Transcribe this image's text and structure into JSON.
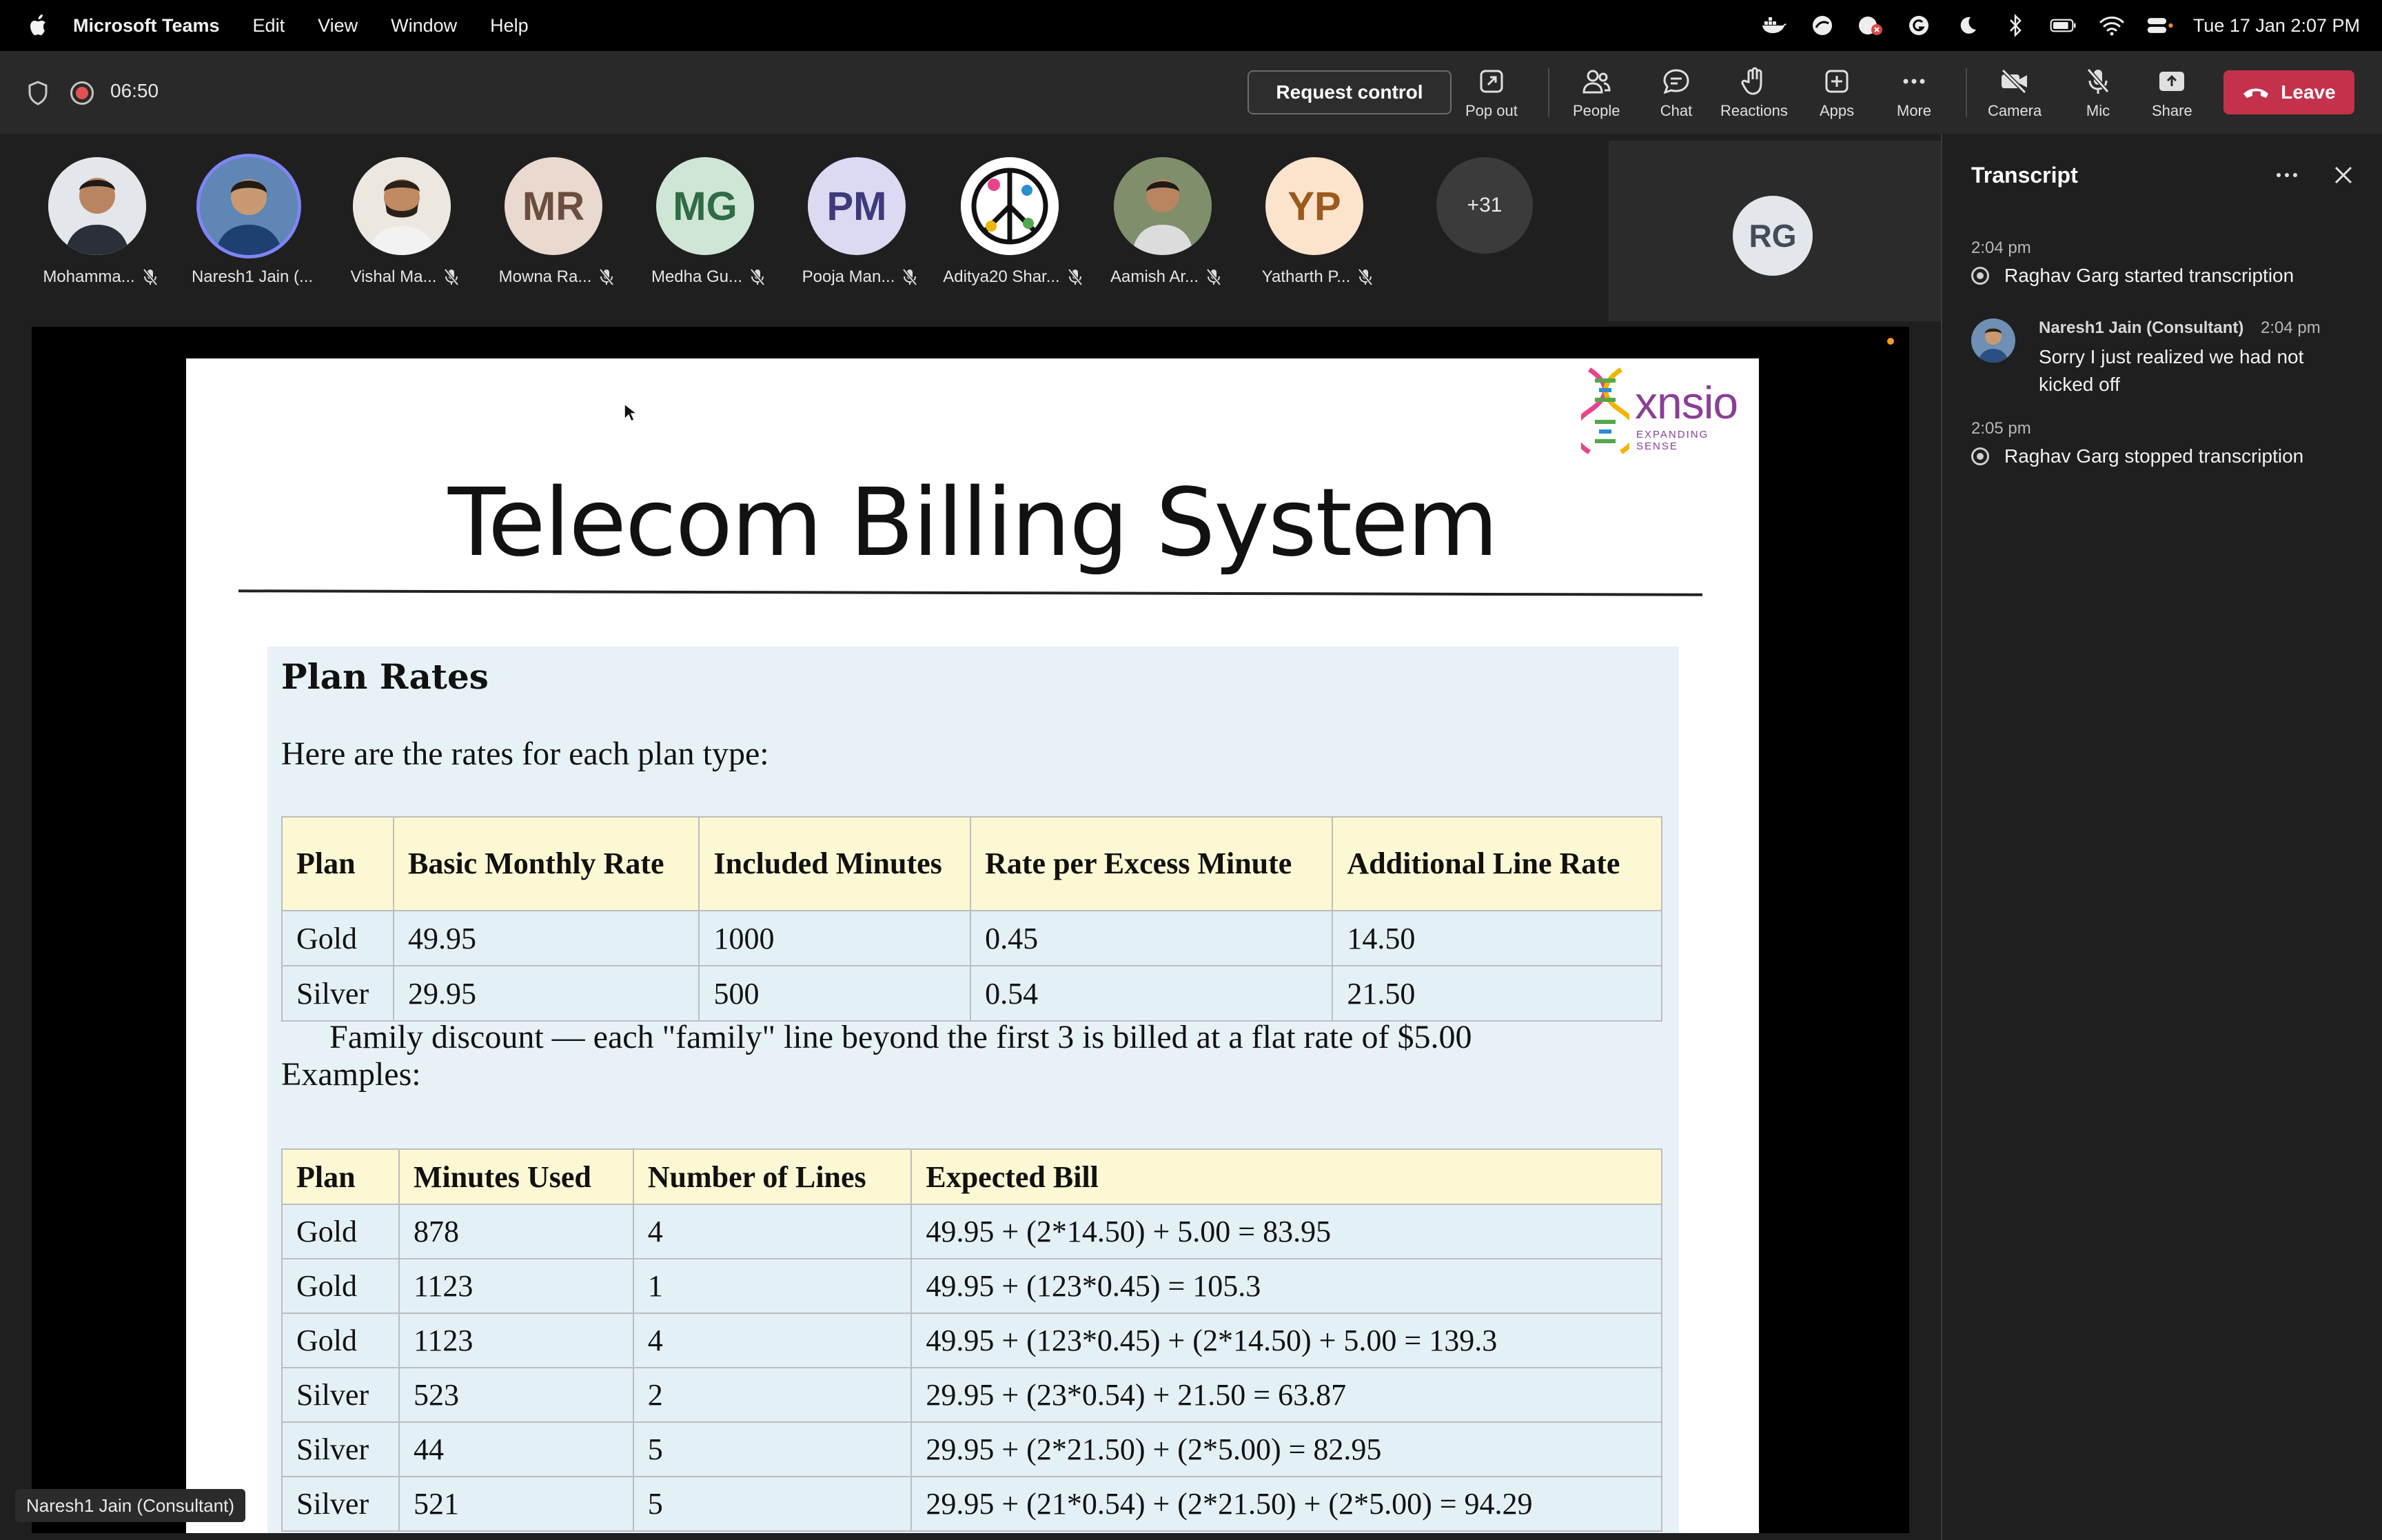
{
  "menubar": {
    "app_name": "Microsoft Teams",
    "items": [
      "Edit",
      "View",
      "Window",
      "Help"
    ],
    "clock": "Tue 17 Jan  2:07 PM"
  },
  "meeting": {
    "timer": "06:50",
    "request_control_label": "Request control",
    "toolbar": {
      "popout": "Pop out",
      "people": "People",
      "chat": "Chat",
      "reactions": "Reactions",
      "apps": "Apps",
      "more": "More",
      "camera": "Camera",
      "mic": "Mic",
      "share": "Share",
      "leave": "Leave"
    }
  },
  "participants": [
    {
      "name": "Mohamma...",
      "initials": "",
      "bg": "#dfe3e8"
    },
    {
      "name": "Naresh1 Jain (...",
      "initials": "",
      "bg": "#5b7fa8"
    },
    {
      "name": "Vishal Ma...",
      "initials": "",
      "bg": "#e9e4dd"
    },
    {
      "name": "Mowna Ra...",
      "initials": "MR",
      "bg": "#ead9cf",
      "fg": "#6b4e3f"
    },
    {
      "name": "Medha Gu...",
      "initials": "MG",
      "bg": "#cfe6d6",
      "fg": "#2f6b45"
    },
    {
      "name": "Pooja Man...",
      "initials": "PM",
      "bg": "#dcdaf2",
      "fg": "#3f3a7a"
    },
    {
      "name": "Aditya20 Shar...",
      "initials": "",
      "bg": "#ffffff"
    },
    {
      "name": "Aamish Ar...",
      "initials": "",
      "bg": "#7c8c6a"
    },
    {
      "name": "Yatharth P...",
      "initials": "YP",
      "bg": "#fbe3cc",
      "fg": "#9a5a1f"
    }
  ],
  "overflow_count": "+31",
  "spotlight_initials": "RG",
  "presenter_tag": "Naresh1 Jain (Consultant)",
  "slide": {
    "logo_word": "xnsio",
    "logo_tagline": "EXPANDING SENSE",
    "title": "Telecom Billing System",
    "heading": "Plan Rates",
    "intro": "Here are the rates for each plan type:",
    "rates_headers": [
      "Plan",
      "Basic Monthly Rate",
      "Included Minutes",
      "Rate per Excess Minute",
      "Additional Line Rate"
    ],
    "rates_rows": [
      [
        "Gold",
        "49.95",
        "1000",
        "0.45",
        "14.50"
      ],
      [
        "Silver",
        "29.95",
        "500",
        "0.54",
        "21.50"
      ]
    ],
    "family_text": "Family discount — each \"family\" line beyond the first 3 is billed at a flat rate of $5.00",
    "examples_label": "Examples:",
    "examples_headers": [
      "Plan",
      "Minutes Used",
      "Number of Lines",
      "Expected Bill"
    ],
    "examples_rows": [
      [
        "Gold",
        "878",
        "4",
        "49.95 + (2*14.50) + 5.00 = 83.95"
      ],
      [
        "Gold",
        "1123",
        "1",
        "49.95 + (123*0.45) = 105.3"
      ],
      [
        "Gold",
        "1123",
        "4",
        "49.95 + (123*0.45) + (2*14.50) + 5.00 = 139.3"
      ],
      [
        "Silver",
        "523",
        "2",
        "29.95 + (23*0.54) + 21.50 = 63.87"
      ],
      [
        "Silver",
        "44",
        "5",
        "29.95 + (2*21.50) + (2*5.00) = 82.95"
      ],
      [
        "Silver",
        "521",
        "5",
        "29.95 + (21*0.54) + (2*21.50) + (2*5.00) = 94.29"
      ]
    ]
  },
  "transcript": {
    "title": "Transcript",
    "entries": [
      {
        "time": "2:04 pm",
        "text": "Raghav Garg started transcription"
      },
      {
        "author": "Naresh1 Jain (Consultant)",
        "time": "2:04 pm",
        "text": "Sorry I just realized we had not kicked off"
      },
      {
        "time": "2:05 pm",
        "text": "Raghav Garg stopped transcription"
      }
    ]
  }
}
